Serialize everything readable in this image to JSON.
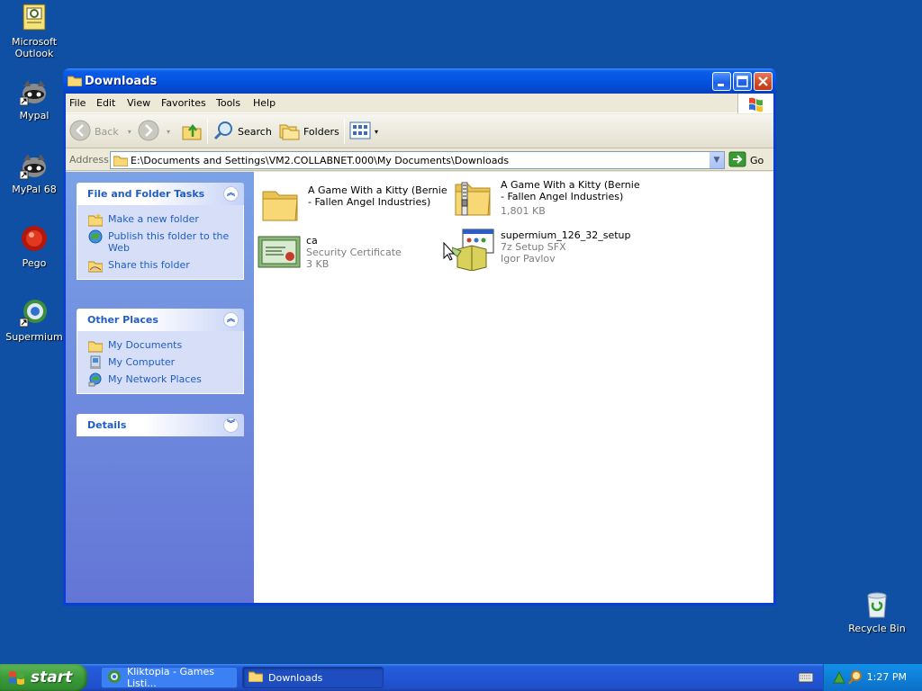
{
  "desktop": {
    "icons": [
      {
        "label": "Microsoft Outlook"
      },
      {
        "label": "Mypal"
      },
      {
        "label": "MyPal 68"
      },
      {
        "label": "Pego"
      },
      {
        "label": "Supermium"
      },
      {
        "label": "Recycle Bin"
      }
    ]
  },
  "window": {
    "title": "Downloads",
    "menu": [
      "File",
      "Edit",
      "View",
      "Favorites",
      "Tools",
      "Help"
    ],
    "toolbar": {
      "back": "Back",
      "search": "Search",
      "folders": "Folders"
    },
    "address": {
      "label": "Address",
      "path": "E:\\Documents and Settings\\VM2.COLLABNET.000\\My Documents\\Downloads",
      "go": "Go"
    },
    "taskpane": {
      "file_tasks": {
        "title": "File and Folder Tasks",
        "items": [
          "Make a new folder",
          "Publish this folder to the Web",
          "Share this folder"
        ]
      },
      "other_places": {
        "title": "Other Places",
        "items": [
          "My Documents",
          "My Computer",
          "My Network Places"
        ]
      },
      "details": {
        "title": "Details"
      }
    },
    "files": [
      {
        "name": "A Game With a Kitty (Bernie - Fallen Angel Industries)",
        "type": "",
        "detail": "",
        "icon": "folder-icon"
      },
      {
        "name": "A Game With a Kitty (Bernie - Fallen Angel Industries)",
        "type": "1,801 KB",
        "detail": "",
        "icon": "zip-folder-icon"
      },
      {
        "name": "ca",
        "type": "Security Certificate",
        "detail": "3 KB",
        "icon": "certificate-icon"
      },
      {
        "name": "supermium_126_32_setup",
        "type": "7z Setup SFX",
        "detail": "Igor Pavlov",
        "icon": "installer-icon"
      }
    ]
  },
  "taskbar": {
    "start": "start",
    "tasks": [
      {
        "label": "Kliktopia - Games Listi..."
      },
      {
        "label": "Downloads"
      }
    ],
    "clock": "1:27 PM"
  },
  "colors": {
    "desktop": "#0f4fa4",
    "titlebar": "#0553e2",
    "taskpane_link": "#215dc6"
  }
}
